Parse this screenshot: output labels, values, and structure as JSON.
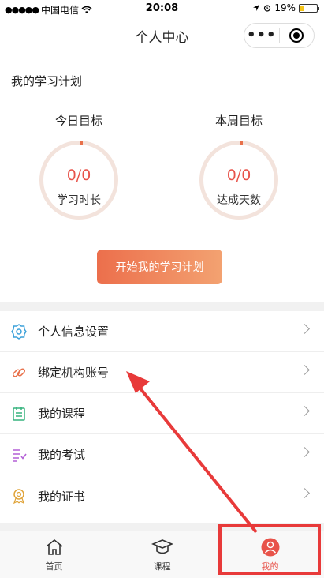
{
  "status_bar": {
    "signal": "●●●●●",
    "carrier": "中国电信",
    "time": "20:08",
    "battery_level": "19%"
  },
  "nav": {
    "title": "个人中心",
    "more_icon": "more-icon",
    "close_icon": "capsule-close-icon"
  },
  "plan": {
    "section_title": "我的学习计划",
    "daily": {
      "label": "今日目标",
      "value": "0/0",
      "sub": "学习时长"
    },
    "weekly": {
      "label": "本周目标",
      "value": "0/0",
      "sub": "达成天数"
    },
    "start_button": "开始我的学习计划"
  },
  "menu": [
    {
      "label": "个人信息设置",
      "icon": "gear-icon",
      "color": "#3ba0d9"
    },
    {
      "label": "绑定机构账号",
      "icon": "link-icon",
      "color": "#e8704a"
    },
    {
      "label": "我的课程",
      "icon": "calendar-list-icon",
      "color": "#36b37e"
    },
    {
      "label": "我的考试",
      "icon": "exam-list-icon",
      "color": "#b35fd6"
    },
    {
      "label": "我的证书",
      "icon": "certificate-icon",
      "color": "#e0a43a"
    }
  ],
  "tabs": [
    {
      "label": "首页",
      "icon": "home-icon"
    },
    {
      "label": "课程",
      "icon": "graduation-cap-icon"
    },
    {
      "label": "我的",
      "icon": "user-icon",
      "active": true
    }
  ],
  "colors": {
    "accent": "#e8534a",
    "button_gradient_start": "#ec6f4c",
    "button_gradient_end": "#f3a271",
    "annotation": "#e83a3a"
  }
}
